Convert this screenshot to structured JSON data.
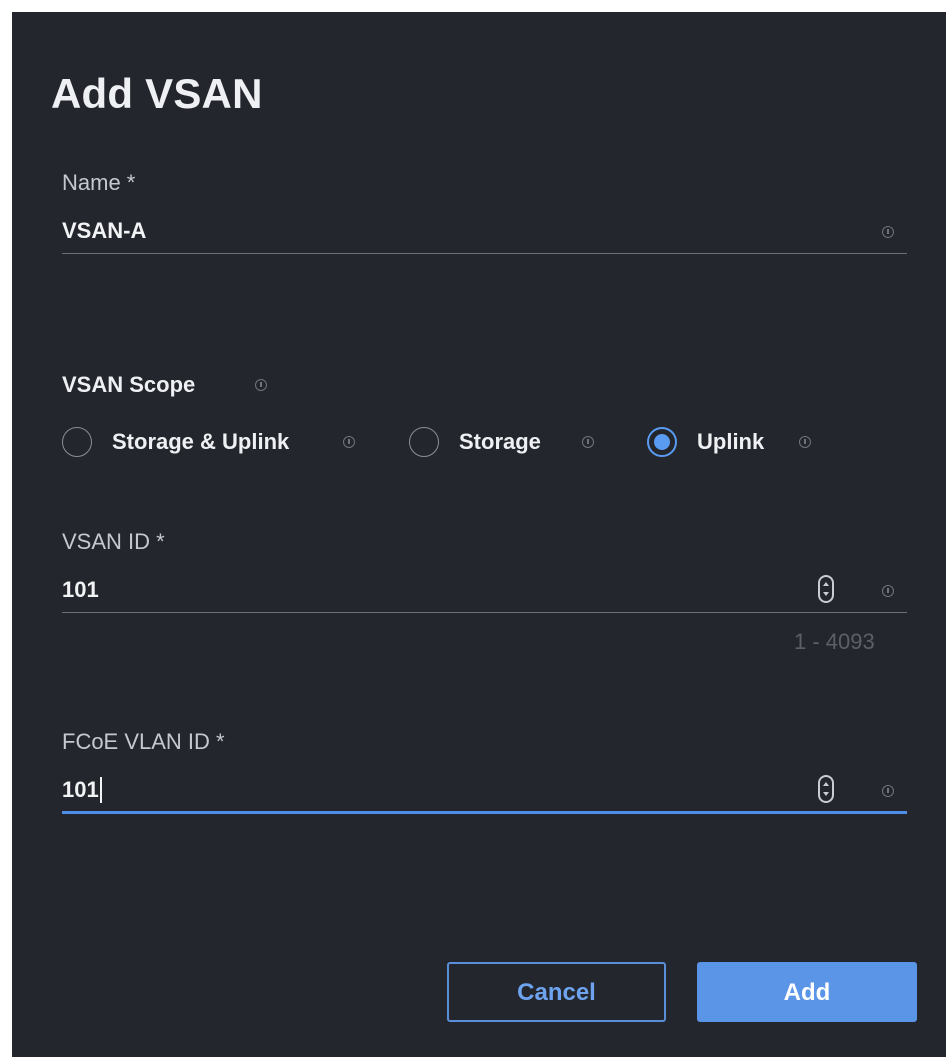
{
  "dialog": {
    "title": "Add VSAN"
  },
  "name_field": {
    "label": "Name *",
    "value": "VSAN-A"
  },
  "scope": {
    "label": "VSAN Scope",
    "options": [
      {
        "label": "Storage & Uplink",
        "selected": false
      },
      {
        "label": "Storage",
        "selected": false
      },
      {
        "label": "Uplink",
        "selected": true
      }
    ]
  },
  "vsan_id_field": {
    "label": "VSAN ID *",
    "value": "101",
    "range_hint": "1 - 4093"
  },
  "fcoe_vlan_field": {
    "label": "FCoE VLAN ID *",
    "value": "101"
  },
  "buttons": {
    "cancel_label": "Cancel",
    "add_label": "Add"
  },
  "colors": {
    "background": "#23262c",
    "accent": "#5b95e8",
    "text": "#eef0f3",
    "muted": "#5b6068"
  },
  "icons": {
    "info": "info-icon",
    "stepper": "number-stepper-icon"
  }
}
